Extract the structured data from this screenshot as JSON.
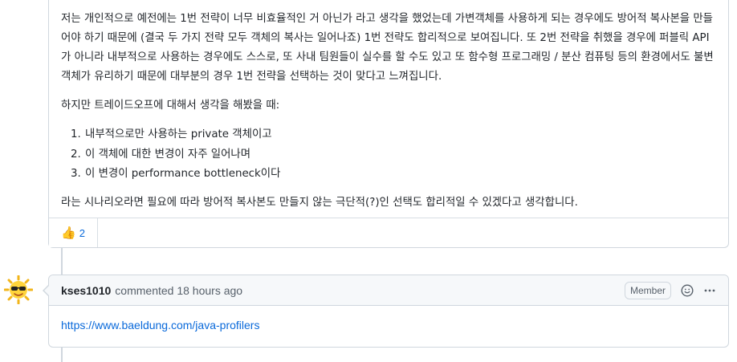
{
  "comment1": {
    "paragraph1": "저는 개인적으로 예전에는 1번 전략이 너무 비효율적인 거 아닌가 라고 생각을 했었는데 가변객체를 사용하게 되는 경우에도 방어적 복사본을 만들어야 하기 때문에 (결국 두 가지 전략 모두 객체의 복사는 일어나죠) 1번 전략도 합리적으로 보여집니다. 또 2번 전략을 취했을 경우에 퍼블릭 API가 아니라 내부적으로 사용하는 경우에도 스스로, 또 사내 팀원들이 실수를 할 수도 있고 또 함수형 프로그래밍 / 분산 컴퓨팅 등의 환경에서도 불변객체가 유리하기 때문에 대부분의 경우 1번 전략을 선택하는 것이 맞다고 느껴집니다.",
    "paragraph2": "하지만 트레이드오프에 대해서 생각을 해봤을 때:",
    "list": [
      "내부적으로만 사용하는 private 객체이고",
      "이 객체에 대한 변경이 자주 일어나며",
      "이 변경이 performance bottleneck이다"
    ],
    "paragraph3": "라는 시나리오라면 필요에 따라 방어적 복사본도 만들지 않는 극단적(?)인 선택도 합리적일 수 있겠다고 생각합니다.",
    "reaction": {
      "icon": "thumbs-up",
      "count": "2"
    }
  },
  "comment2": {
    "author": "kses1010",
    "meta": "commented 18 hours ago",
    "badge": "Member",
    "link": "https://www.baeldung.com/java-profilers"
  }
}
